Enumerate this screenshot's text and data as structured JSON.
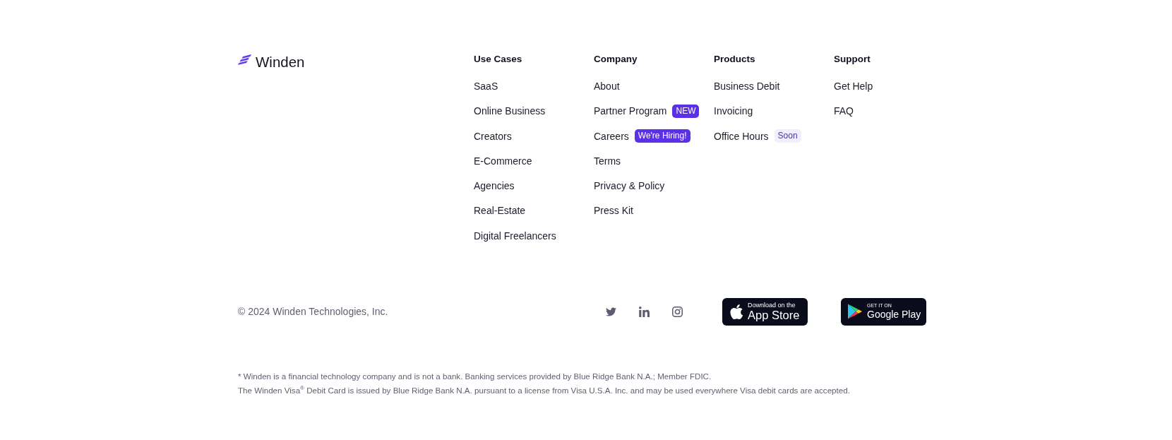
{
  "logo": {
    "name": "Winden"
  },
  "columns": [
    {
      "heading": "Use Cases",
      "links": [
        {
          "label": "SaaS"
        },
        {
          "label": "Online Business"
        },
        {
          "label": "Creators"
        },
        {
          "label": "E-Commerce"
        },
        {
          "label": "Agencies"
        },
        {
          "label": "Real-Estate"
        },
        {
          "label": "Digital Freelancers"
        }
      ]
    },
    {
      "heading": "Company",
      "links": [
        {
          "label": "About"
        },
        {
          "label": "Partner Program",
          "badge": {
            "text": "NEW",
            "kind": "solid"
          }
        },
        {
          "label": "Careers",
          "badge": {
            "text": "We're Hiring!",
            "kind": "solid"
          }
        },
        {
          "label": "Terms"
        },
        {
          "label": "Privacy & Policy"
        },
        {
          "label": "Press Kit"
        }
      ]
    },
    {
      "heading": "Products",
      "links": [
        {
          "label": "Business Debit"
        },
        {
          "label": "Invoicing"
        },
        {
          "label": "Office Hours",
          "badge": {
            "text": "Soon",
            "kind": "soft"
          }
        }
      ]
    },
    {
      "heading": "Support",
      "links": [
        {
          "label": "Get Help"
        },
        {
          "label": "FAQ"
        }
      ]
    }
  ],
  "copyright": "© 2024 Winden Technologies, Inc.",
  "app_badges": [
    {
      "kind": "apple",
      "caption": "Download on the",
      "title": "App Store"
    },
    {
      "kind": "google",
      "caption": "GET IT ON",
      "title": "Google Play"
    }
  ],
  "disclaimer": [
    "* Winden is a financial technology company and is not a bank. Banking services provided by Blue Ridge Bank N.A.; Member FDIC.",
    "The Winden Visa$^{®}$ Debit Card is issued by Blue Ridge Bank N.A. pursuant to a license from Visa U.S.A. Inc. and may be used everywhere Visa debit cards are accepted."
  ]
}
